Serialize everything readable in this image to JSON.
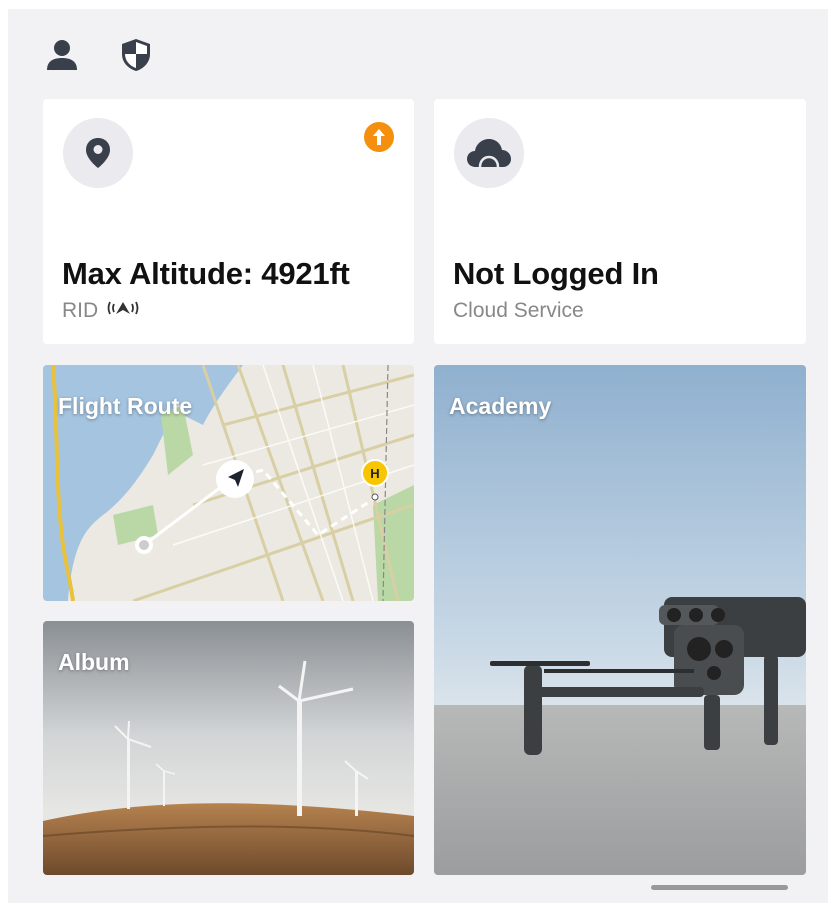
{
  "header": {
    "icons": [
      "user-icon",
      "shield-icon"
    ]
  },
  "cards": {
    "altitude": {
      "title": "Max Altitude: 4921ft",
      "subtitle": "RID",
      "icon": "location-pin-icon",
      "badge": "update-arrow-icon"
    },
    "cloud": {
      "title": "Not Logged In",
      "subtitle": "Cloud Service",
      "icon": "cloud-icon"
    }
  },
  "tiles": {
    "flight_route": {
      "label": "Flight Route"
    },
    "academy": {
      "label": "Academy"
    },
    "album": {
      "label": "Album"
    }
  },
  "colors": {
    "accent_orange": "#f5900f",
    "home_marker": "#f7c600",
    "icon_dark": "#3a3f4c"
  }
}
